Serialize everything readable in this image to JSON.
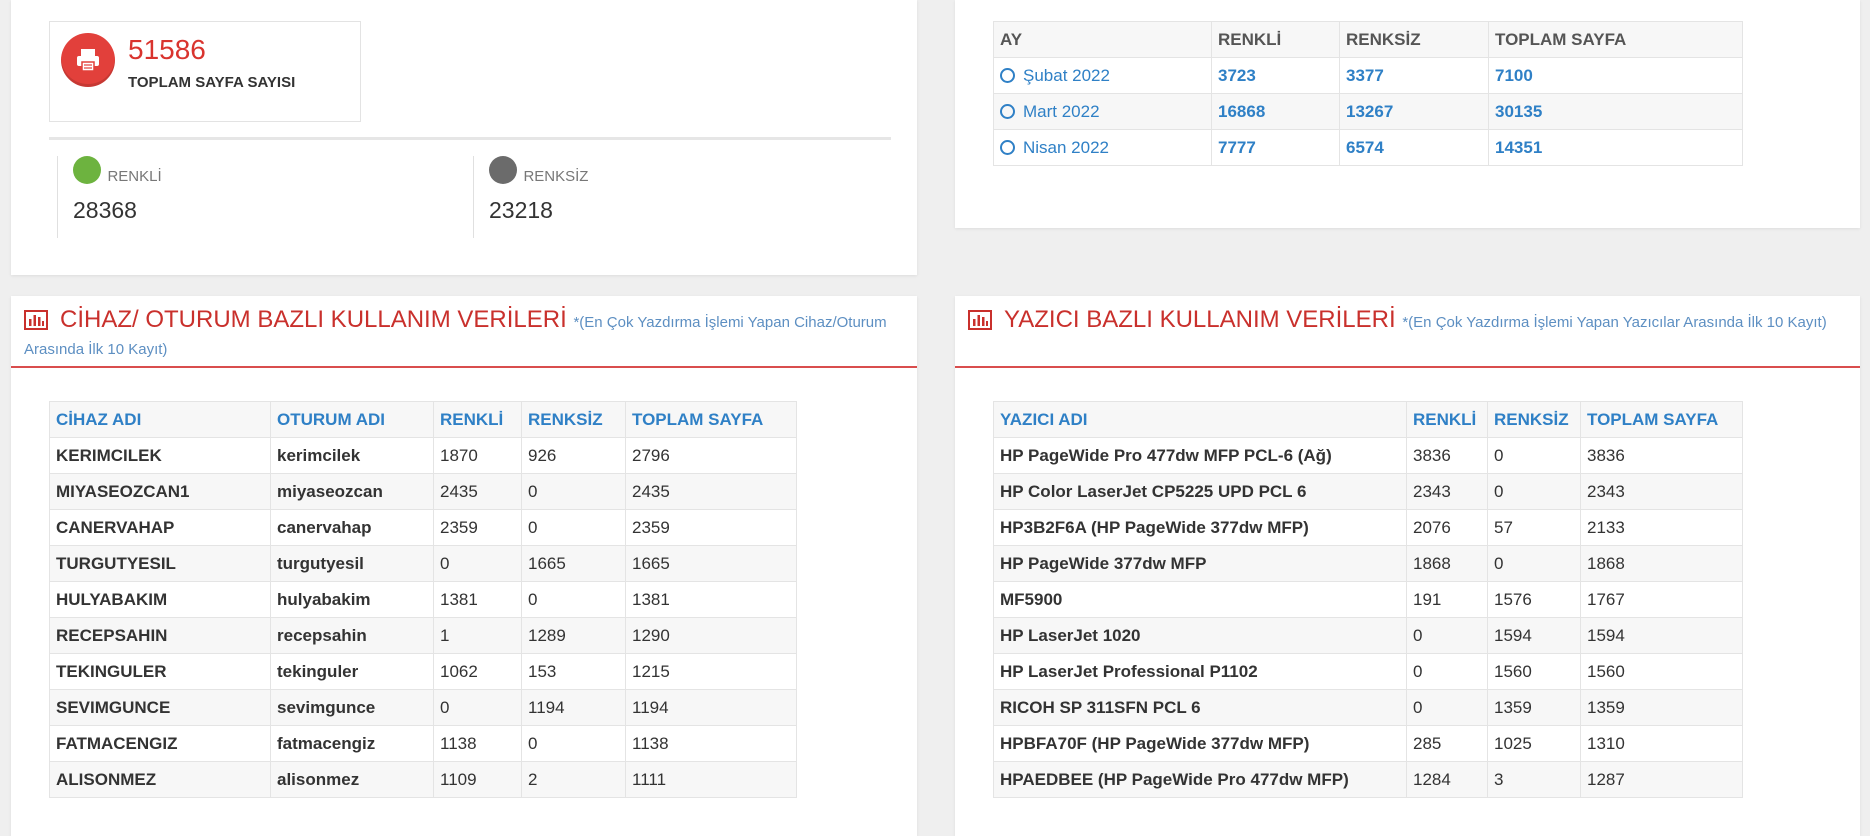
{
  "summary": {
    "total_value": "51586",
    "total_label": "TOPLAM SAYFA SAYISI",
    "renkli_label": "RENKLİ",
    "renkli_value": "28368",
    "renksiz_label": "RENKSİZ",
    "renksiz_value": "23218",
    "colors": {
      "renkli_dot": "#6db33f",
      "renksiz_dot": "#6b6b6b",
      "accent": "#d9342e"
    }
  },
  "monthly": {
    "headers": [
      "AY",
      "RENKLİ",
      "RENKSİZ",
      "TOPLAM SAYFA"
    ],
    "rows": [
      [
        "Şubat 2022",
        "3723",
        "3377",
        "7100"
      ],
      [
        "Mart 2022",
        "16868",
        "13267",
        "30135"
      ],
      [
        "Nisan 2022",
        "7777",
        "6574",
        "14351"
      ]
    ]
  },
  "device_panel": {
    "title": "CİHAZ/ OTURUM BAZLI KULLANIM VERİLERİ",
    "note_part1": "*(En Çok Yazdırma İşlemi Yapan Cihaz/Oturum",
    "note_part2": "Arasında İlk 10 Kayıt)",
    "headers": [
      "CİHAZ ADI",
      "OTURUM ADI",
      "RENKLİ",
      "RENKSİZ",
      "TOPLAM SAYFA"
    ],
    "rows": [
      [
        "KERIMCILEK",
        "kerimcilek",
        "1870",
        "926",
        "2796"
      ],
      [
        "MIYASEOZCAN1",
        "miyaseozcan",
        "2435",
        "0",
        "2435"
      ],
      [
        "CANERVAHAP",
        "canervahap",
        "2359",
        "0",
        "2359"
      ],
      [
        "TURGUTYESIL",
        "turgutyesil",
        "0",
        "1665",
        "1665"
      ],
      [
        "HULYABAKIM",
        "hulyabakim",
        "1381",
        "0",
        "1381"
      ],
      [
        "RECEPSAHIN",
        "recepsahin",
        "1",
        "1289",
        "1290"
      ],
      [
        "TEKINGULER",
        "tekinguler",
        "1062",
        "153",
        "1215"
      ],
      [
        "SEVIMGUNCE",
        "sevimgunce",
        "0",
        "1194",
        "1194"
      ],
      [
        "FATMACENGIZ",
        "fatmacengiz",
        "1138",
        "0",
        "1138"
      ],
      [
        "ALISONMEZ",
        "alisonmez",
        "1109",
        "2",
        "1111"
      ]
    ]
  },
  "printer_panel": {
    "title": "YAZICI BAZLI KULLANIM VERİLERİ",
    "note": "*(En Çok Yazdırma İşlemi Yapan Yazıcılar Arasında İlk 10 Kayıt)",
    "headers": [
      "YAZICI ADI",
      "RENKLİ",
      "RENKSİZ",
      "TOPLAM SAYFA"
    ],
    "rows": [
      [
        "HP PageWide Pro 477dw MFP PCL-6 (Ağ)",
        "3836",
        "0",
        "3836"
      ],
      [
        "HP Color LaserJet CP5225 UPD PCL 6",
        "2343",
        "0",
        "2343"
      ],
      [
        "HP3B2F6A (HP PageWide 377dw MFP)",
        "2076",
        "57",
        "2133"
      ],
      [
        "HP PageWide 377dw MFP",
        "1868",
        "0",
        "1868"
      ],
      [
        "MF5900",
        "191",
        "1576",
        "1767"
      ],
      [
        "HP LaserJet 1020",
        "0",
        "1594",
        "1594"
      ],
      [
        "HP LaserJet Professional P1102",
        "0",
        "1560",
        "1560"
      ],
      [
        "RICOH SP 311SFN PCL 6",
        "0",
        "1359",
        "1359"
      ],
      [
        "HPBFA70F (HP PageWide 377dw MFP)",
        "285",
        "1025",
        "1310"
      ],
      [
        "HPAEDBEE (HP PageWide Pro 477dw MFP)",
        "1284",
        "3",
        "1287"
      ]
    ]
  }
}
